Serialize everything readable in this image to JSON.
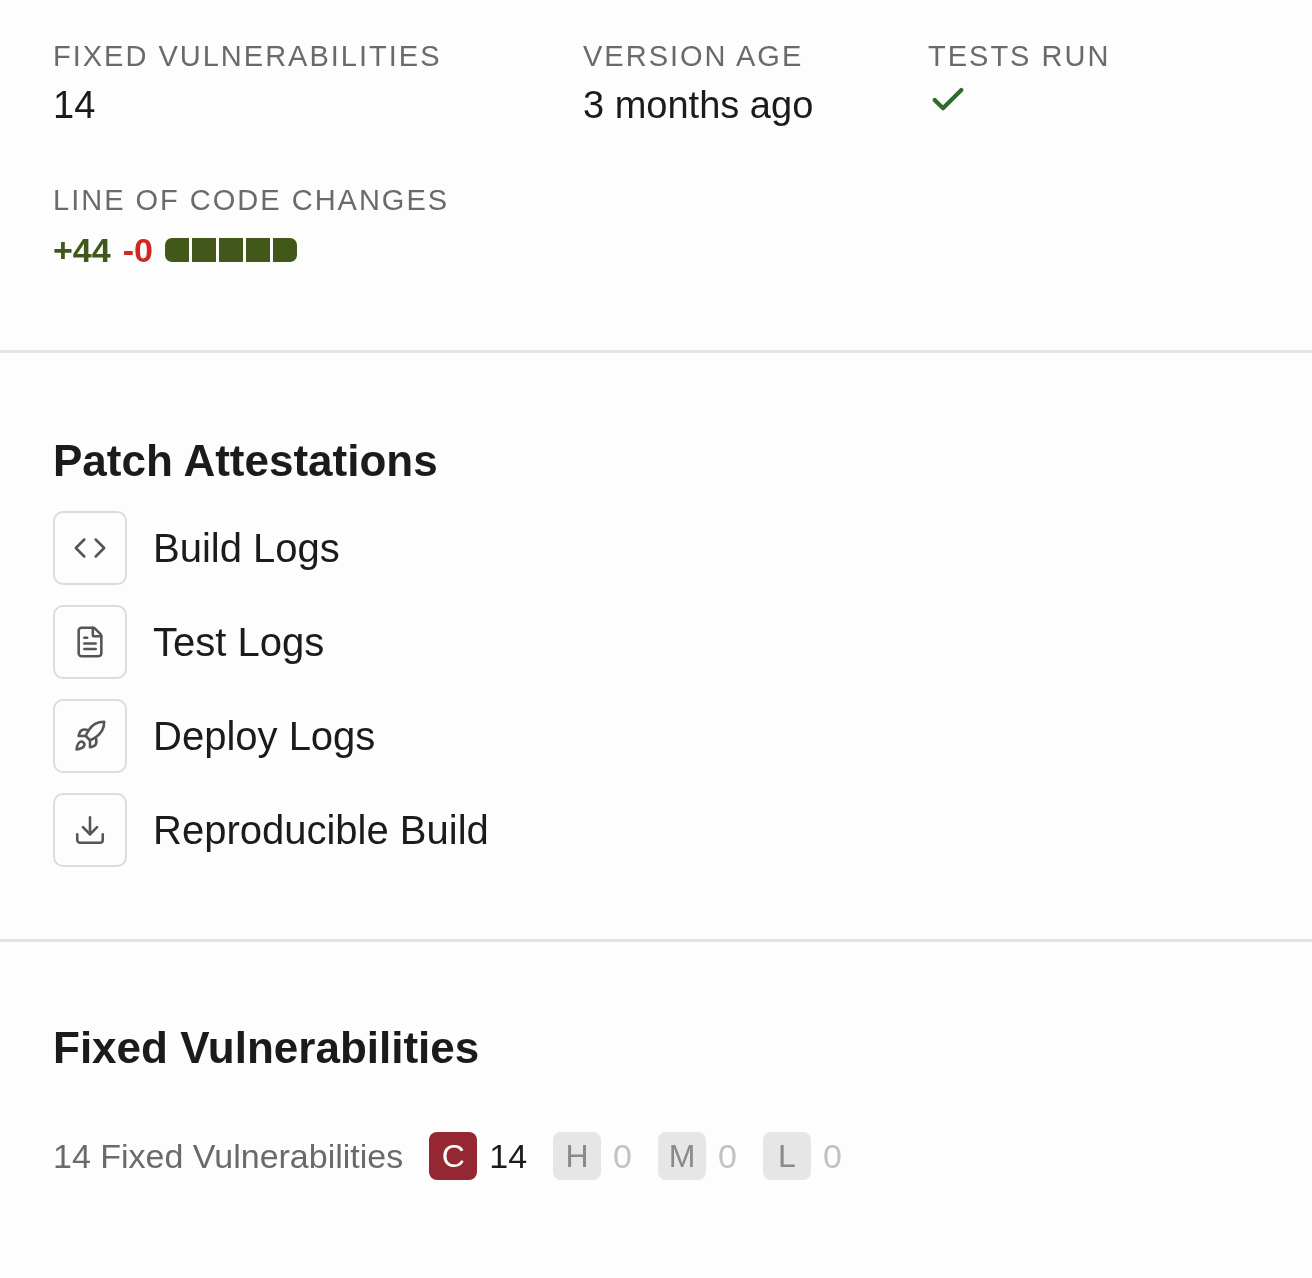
{
  "stats": [
    {
      "kind": "text",
      "label": "FIXED VULNERABILITIES",
      "value": "14"
    },
    {
      "kind": "text",
      "label": "VERSION AGE",
      "value": "3 months ago"
    },
    {
      "kind": "check",
      "label": "TESTS RUN",
      "passed": true
    }
  ],
  "code_changes": {
    "label": "LINE OF CODE CHANGES",
    "added": "+44",
    "removed": "-0",
    "level": 1
  },
  "attestations": {
    "title": "Patch Attestations",
    "items": [
      {
        "kind": "code",
        "label": "Build Logs"
      },
      {
        "kind": "file",
        "label": "Test Logs"
      },
      {
        "kind": "rocket",
        "label": "Deploy Logs"
      },
      {
        "kind": "download",
        "label": "Reproducible Build"
      }
    ]
  },
  "vulnerabilities": {
    "title": "Fixed Vulnerabilities",
    "summary": "14 Fixed Vulnerabilities",
    "severities": [
      {
        "letter": "C",
        "count": "14",
        "active": true
      },
      {
        "letter": "H",
        "count": "0",
        "active": false
      },
      {
        "letter": "M",
        "count": "0",
        "active": false
      },
      {
        "letter": "L",
        "count": "0",
        "active": false
      }
    ]
  }
}
